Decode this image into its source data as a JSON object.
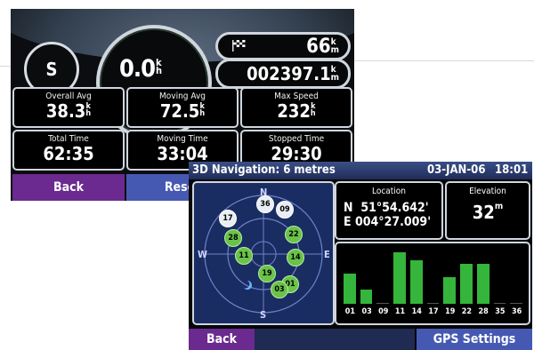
{
  "trip": {
    "direction": "S",
    "speed_value": "0.0",
    "speed_unit_top": "k",
    "speed_unit_bottom": "h",
    "odo_distance": "66",
    "odo_unit_top": "k",
    "odo_unit_bottom": "m",
    "odometer": "002397.1",
    "stats": [
      {
        "label": "Overall Avg",
        "value": "38.3",
        "unit_top": "k",
        "unit_bottom": "h"
      },
      {
        "label": "Moving Avg",
        "value": "72.5",
        "unit_top": "k",
        "unit_bottom": "h"
      },
      {
        "label": "Max Speed",
        "value": "232",
        "unit_top": "k",
        "unit_bottom": "h"
      },
      {
        "label": "Total Time",
        "value": "62:35",
        "unit_top": "",
        "unit_bottom": ""
      },
      {
        "label": "Moving Time",
        "value": "33:04",
        "unit_top": "",
        "unit_bottom": ""
      },
      {
        "label": "Stopped Time",
        "value": "29:30",
        "unit_top": "",
        "unit_bottom": ""
      }
    ],
    "back_label": "Back",
    "reset_label": "Reset"
  },
  "gps": {
    "title": "3D Navigation: 6 metres",
    "date": "03-JAN-06",
    "time": "18:01",
    "cardinals": {
      "n": "N",
      "s": "S",
      "e": "E",
      "w": "W"
    },
    "satellites": [
      {
        "id": "36",
        "state": "off"
      },
      {
        "id": "09",
        "state": "off"
      },
      {
        "id": "17",
        "state": "off"
      },
      {
        "id": "28",
        "state": "on"
      },
      {
        "id": "22",
        "state": "on"
      },
      {
        "id": "11",
        "state": "on"
      },
      {
        "id": "14",
        "state": "on"
      },
      {
        "id": "19",
        "state": "on"
      },
      {
        "id": "01",
        "state": "on"
      },
      {
        "id": "03",
        "state": "on"
      }
    ],
    "location_label": "Location",
    "lat_dir": "N",
    "lat": "51°54.642'",
    "lon_dir": "E",
    "lon": "004°27.009'",
    "elevation_label": "Elevation",
    "elevation_value": "32",
    "elevation_unit": "m",
    "signal_labels": [
      "01",
      "03",
      "09",
      "11",
      "14",
      "17",
      "19",
      "22",
      "28",
      "35",
      "36"
    ],
    "signal_levels": [
      0.58,
      0.28,
      0.0,
      1.0,
      0.85,
      0.0,
      0.52,
      0.78,
      0.78,
      0.0,
      0.0
    ],
    "back_label": "Back",
    "settings_label": "GPS Settings"
  },
  "colors": {
    "purple_button": "#6b2a8f",
    "blue_button": "#4659b2",
    "signal_green": "#35b53b",
    "sky_blue": "#1a2d63"
  }
}
